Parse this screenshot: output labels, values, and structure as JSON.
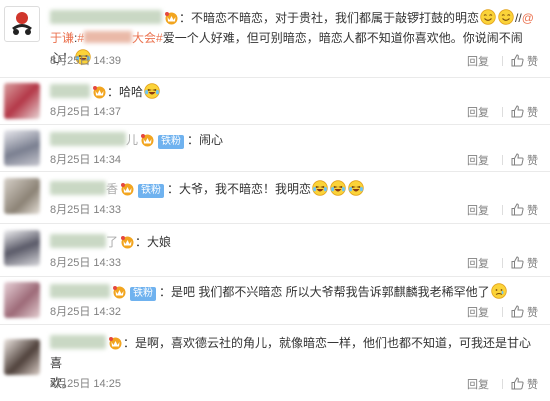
{
  "comments": [
    {
      "time": "8月25日 14:39",
      "reply": "回复",
      "like": "赞",
      "t1": "：不暗恋不暗恋，对于贵社，我们都属于敲锣打鼓的明恋",
      "t2": "//",
      "mention": "@于谦",
      "t3": ":",
      "topic_prefix": "#",
      "topic_suffix": "大会#",
      "t4": "爱一个人好难，但可别暗恋，暗恋人都不知道你喜欢他。你说闹不闹心！"
    },
    {
      "time": "8月25日 14:37",
      "reply": "回复",
      "like": "赞",
      "t1": "：哈哈"
    },
    {
      "time": "8月25日 14:34",
      "reply": "回复",
      "like": "赞",
      "fan": "铁粉",
      "t1": "：闹心",
      "name_tail": "儿"
    },
    {
      "time": "8月25日 14:33",
      "reply": "回复",
      "like": "赞",
      "fan": "铁粉",
      "t1": "：大爷，我不暗恋！我明恋",
      "name_tail": "香"
    },
    {
      "time": "8月25日 14:33",
      "reply": "回复",
      "like": "赞",
      "t1": "：大娘",
      "name_tail": "了"
    },
    {
      "time": "8月25日 14:32",
      "reply": "回复",
      "like": "赞",
      "fan": "铁粉",
      "t1": "：是吧 我们都不兴暗恋 所以大爷帮我告诉郭麒麟我老稀罕他了"
    },
    {
      "time": "8月25日 14:25",
      "reply": "回复",
      "like": "赞",
      "t1": "：是啊，喜欢德云社的角儿，就像暗恋一样，他们也都不知道，可我还是甘心喜",
      "t2": "欢。"
    }
  ],
  "colors": {
    "accent": "#eb7350",
    "fan_badge": "#6fb2ef",
    "meta": "#808080"
  },
  "icons": [
    "crown-badge-icon",
    "smile-emoji-icon",
    "laughing-cry-emoji-icon",
    "sad-emoji-icon",
    "like-thumb-icon"
  ]
}
